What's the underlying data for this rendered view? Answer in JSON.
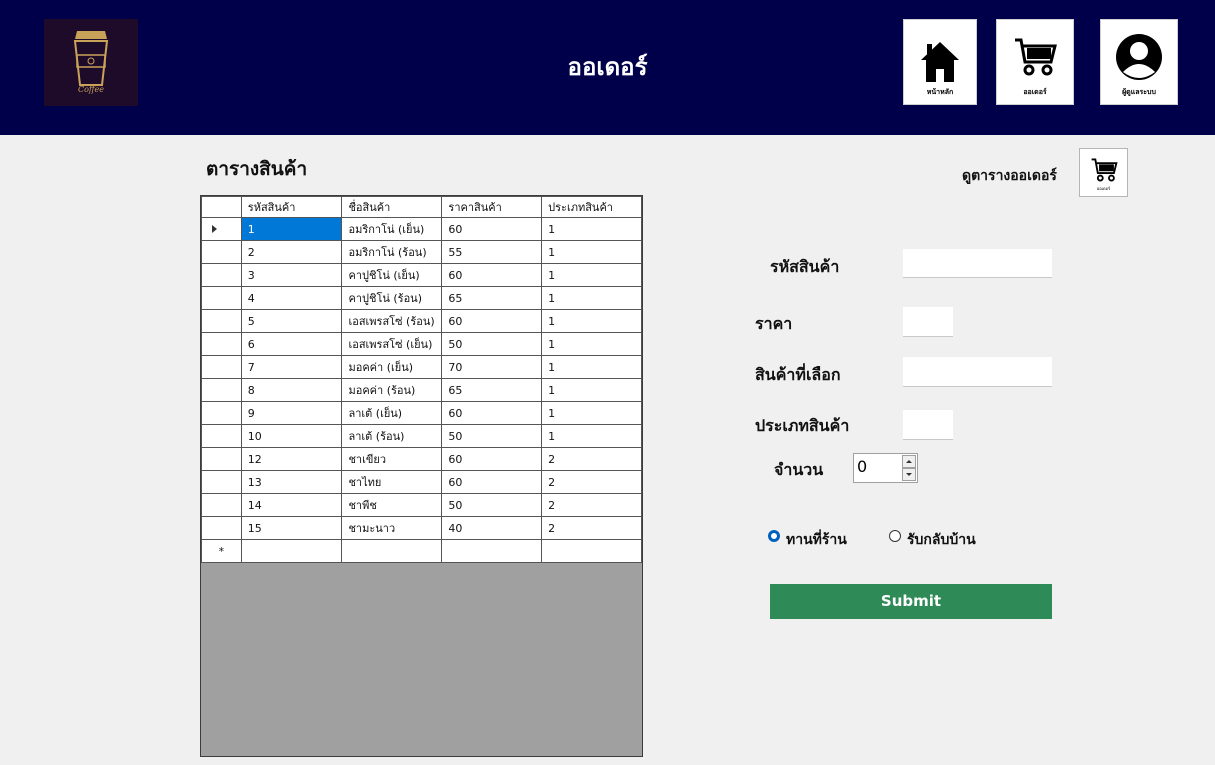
{
  "header": {
    "title": "ออเดอร์",
    "logo_text": "Coffee",
    "nav": [
      {
        "label": "หน้าหลัก",
        "icon": "home-icon"
      },
      {
        "label": "ออเดอร์",
        "icon": "cart-icon"
      },
      {
        "label": "ผู้ดูแลระบบ",
        "icon": "user-icon"
      }
    ]
  },
  "products": {
    "title": "ตารางสินค้า",
    "view_orders_label": "ดูตารางออเดอร์",
    "view_orders_icon_label": "ออเดอร์",
    "columns": [
      "รหัสสินค้า",
      "ชื่อสินค้า",
      "ราคาสินค้า",
      "ประเภทสินค้า"
    ],
    "rows": [
      [
        "1",
        "อมริกาโน่ (เย็น)",
        "60",
        "1"
      ],
      [
        "2",
        "อมริกาโน่ (ร้อน)",
        "55",
        "1"
      ],
      [
        "3",
        "คาปูชิโน่ (เย็น)",
        "60",
        "1"
      ],
      [
        "4",
        "คาปูชิโน่ (ร้อน)",
        "65",
        "1"
      ],
      [
        "5",
        "เอสเพรสโซ่ (ร้อน)",
        "60",
        "1"
      ],
      [
        "6",
        "เอสเพรสโซ่ (เย็น)",
        "50",
        "1"
      ],
      [
        "7",
        "มอคค่า (เย็น)",
        "70",
        "1"
      ],
      [
        "8",
        "มอคค่า (ร้อน)",
        "65",
        "1"
      ],
      [
        "9",
        "ลาเต้ (เย็น)",
        "60",
        "1"
      ],
      [
        "10",
        "ลาเต้ (ร้อน)",
        "50",
        "1"
      ],
      [
        "12",
        "ชาเขียว",
        "60",
        "2"
      ],
      [
        "13",
        "ชาไทย",
        "60",
        "2"
      ],
      [
        "14",
        "ชาพีช",
        "50",
        "2"
      ],
      [
        "15",
        "ชามะนาว",
        "40",
        "2"
      ]
    ],
    "new_row_marker": "*"
  },
  "form": {
    "product_code_label": "รหัสสินค้า",
    "product_code_value": "",
    "price_label": "ราคา",
    "price_value": "",
    "selected_product_label": "สินค้าที่เลือก",
    "selected_product_value": "",
    "category_label": "ประเภทสินค้า",
    "category_value": "",
    "quantity_label": "จำนวน",
    "quantity_value": "0",
    "dine_in_label": "ทานที่ร้าน",
    "takeaway_label": "รับกลับบ้าน",
    "selected_option": "dine_in",
    "submit_label": "Submit"
  },
  "colors": {
    "header_bg": "#00004a",
    "submit_bg": "#2e8b57",
    "selection": "#0078d7"
  }
}
